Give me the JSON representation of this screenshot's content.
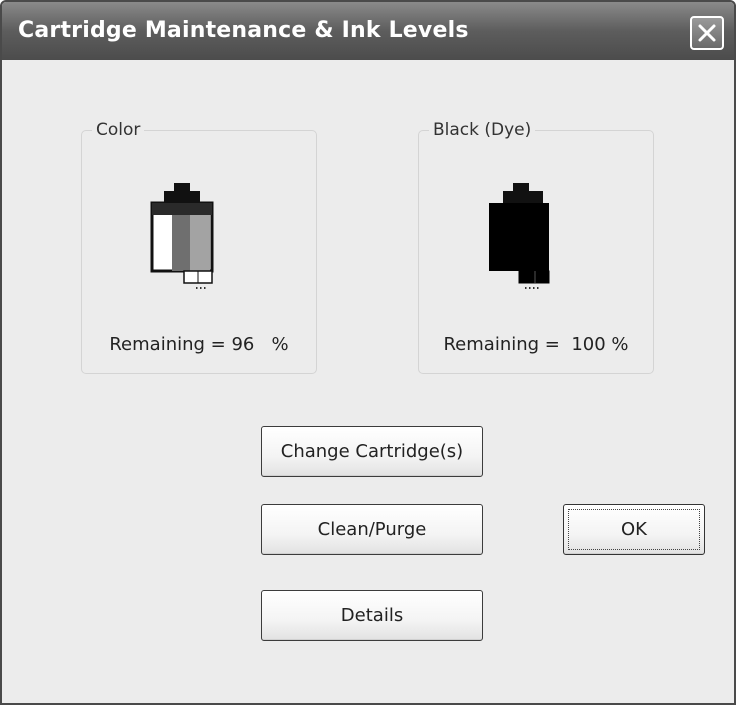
{
  "window": {
    "title": "Cartridge Maintenance & Ink Levels",
    "close_icon": "close-icon"
  },
  "color_group": {
    "label": "Color",
    "remaining_text": "Remaining = 96   %",
    "remaining_percent": 96
  },
  "black_group": {
    "label": "Black (Dye)",
    "remaining_text": "Remaining =  100 %",
    "remaining_percent": 100
  },
  "buttons": {
    "change_cartridges": "Change Cartridge(s)",
    "clean_purge": "Clean/Purge",
    "details": "Details",
    "ok": "OK"
  },
  "colors": {
    "titlebar": "#5d5d5d",
    "background": "#ececec",
    "black_ink": "#000000"
  }
}
